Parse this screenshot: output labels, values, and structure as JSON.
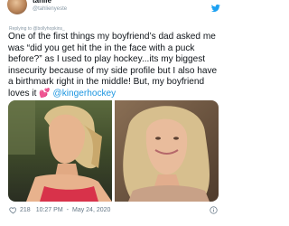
{
  "tweet": {
    "display_name": "tahlie",
    "handle": "@tahlienyeste",
    "replying_prefix": "Replying to",
    "replying_to": "@bollyhopkins_",
    "body_text": "One of the first things my boyfriend’s dad asked me was “did you get hit the in the face with a puck before?” as I used to play hockey...its my biggest insecurity because of my side profile but I also have a birthmark right in the middle! But, my boyfriend loves it ",
    "emoji": "💕",
    "mention_link": "@kingerhockey",
    "likes": "218",
    "time": "10:27 PM",
    "separator": "-",
    "date": "May 24, 2020"
  },
  "icons": {
    "brand": "twitter-bird-icon",
    "like": "heart-icon",
    "info": "info-icon"
  },
  "colors": {
    "link": "#1b95e0",
    "muted": "#657786",
    "text": "#0f1419"
  }
}
